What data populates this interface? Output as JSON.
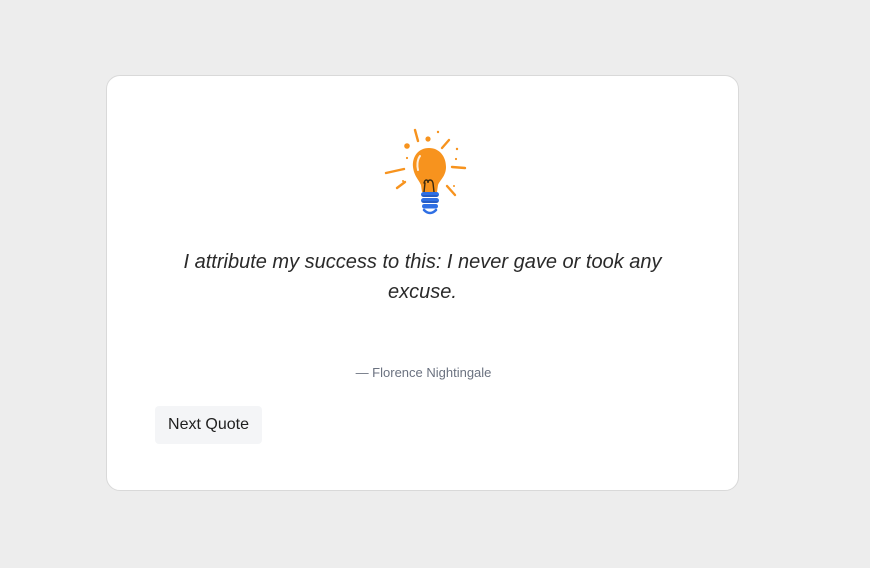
{
  "quote": {
    "text": "I attribute my success to this: I never gave or took any excuse.",
    "author": "— Florence Nightingale"
  },
  "actions": {
    "next_label": "Next Quote"
  },
  "colors": {
    "bulb": "#f7931e",
    "base": "#2f6fe4",
    "text": "#2a2a2a",
    "author": "#6b7280"
  },
  "icons": {
    "bulb": "lightbulb-icon"
  }
}
